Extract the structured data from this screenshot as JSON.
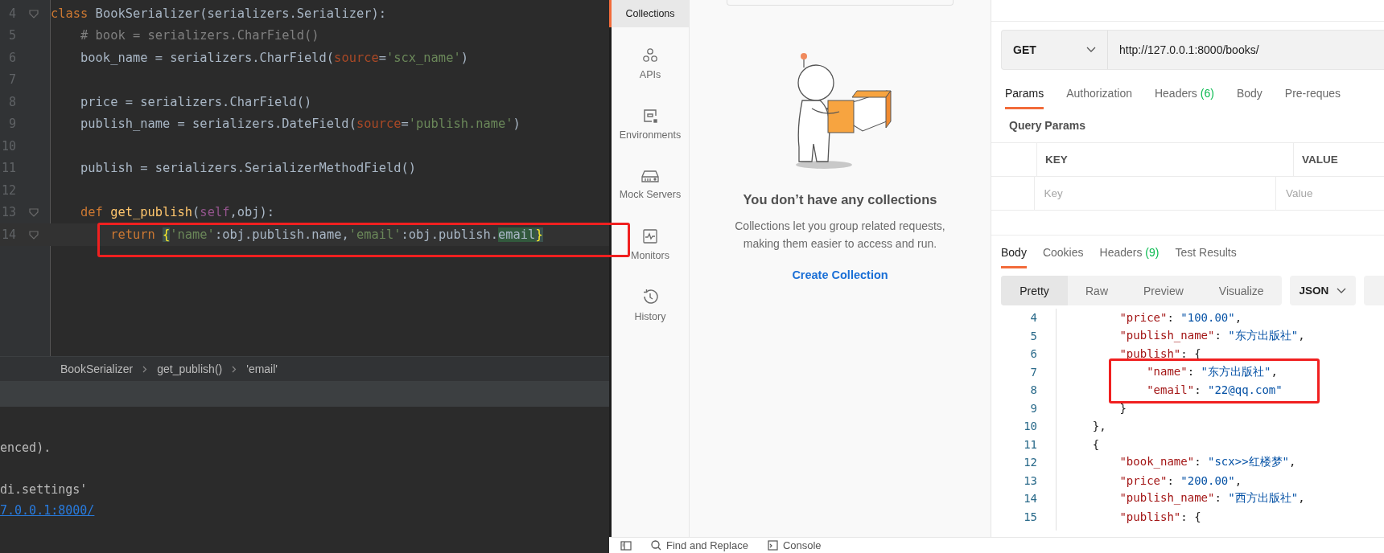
{
  "editor": {
    "lines": [
      {
        "number": "4",
        "fold": true,
        "current": false,
        "tokens": [
          {
            "kind": "keyword",
            "text": "class "
          },
          {
            "kind": "plain",
            "text": "BookSerializer(serializers.Serializer):"
          }
        ]
      },
      {
        "number": "5",
        "fold": false,
        "current": false,
        "tokens": [
          {
            "kind": "comment",
            "text": "    # book = serializers.CharField()"
          }
        ]
      },
      {
        "number": "6",
        "fold": false,
        "current": false,
        "tokens": [
          {
            "kind": "plain",
            "text": "    book_name = serializers.CharField("
          },
          {
            "kind": "param",
            "text": "source"
          },
          {
            "kind": "plain",
            "text": "="
          },
          {
            "kind": "string",
            "text": "'scx_name'"
          },
          {
            "kind": "plain",
            "text": ")"
          }
        ]
      },
      {
        "number": "7",
        "fold": false,
        "current": false
      },
      {
        "number": "8",
        "fold": false,
        "current": false,
        "tokens": [
          {
            "kind": "plain",
            "text": "    price = serializers.CharField()"
          }
        ]
      },
      {
        "number": "9",
        "fold": false,
        "current": false,
        "tokens": [
          {
            "kind": "plain",
            "text": "    publish_name = serializers.DateField("
          },
          {
            "kind": "param",
            "text": "source"
          },
          {
            "kind": "plain",
            "text": "="
          },
          {
            "kind": "string",
            "text": "'publish.name'"
          },
          {
            "kind": "plain",
            "text": ")"
          }
        ]
      },
      {
        "number": "10",
        "fold": false,
        "current": false
      },
      {
        "number": "11",
        "fold": false,
        "current": false,
        "tokens": [
          {
            "kind": "plain",
            "text": "    publish = serializers.SerializerMethodField()"
          }
        ]
      },
      {
        "number": "12",
        "fold": false,
        "current": false
      },
      {
        "number": "13",
        "fold": true,
        "current": false,
        "tokens": [
          {
            "kind": "keyword",
            "text": "    def "
          },
          {
            "kind": "func",
            "text": "get_publish"
          },
          {
            "kind": "plain",
            "text": "("
          },
          {
            "kind": "self",
            "text": "self"
          },
          {
            "kind": "plain",
            "text": ",obj):"
          }
        ]
      },
      {
        "number": "14",
        "fold": true,
        "current": true,
        "tokens": [
          {
            "kind": "keyword",
            "text": "        return "
          },
          {
            "kind": "brace",
            "text": "{"
          },
          {
            "kind": "string",
            "text": "'name'"
          },
          {
            "kind": "plain",
            "text": ":obj.publish.name,"
          },
          {
            "kind": "string",
            "text": "'email'"
          },
          {
            "kind": "plain",
            "text": ":obj.publish."
          },
          {
            "kind": "match",
            "text": "email"
          },
          {
            "kind": "brace",
            "text": "}"
          }
        ]
      }
    ],
    "breadcrumbs": [
      "BookSerializer",
      "get_publish()",
      "'email'"
    ]
  },
  "console": {
    "lines": [
      {
        "kind": "plain",
        "text": "enced)."
      },
      {
        "kind": "plain",
        "text": "di.settings'"
      },
      {
        "kind": "link",
        "text": "7.0.0.1:8000/"
      }
    ]
  },
  "sidebar": {
    "items": [
      {
        "label": "Collections",
        "selected": true
      },
      {
        "label": "APIs",
        "selected": false
      },
      {
        "label": "Environments",
        "selected": false
      },
      {
        "label": "Mock Servers",
        "selected": false
      },
      {
        "label": "Monitors",
        "selected": false
      },
      {
        "label": "History",
        "selected": false
      }
    ]
  },
  "collections": {
    "title": "You don’t have any collections",
    "description": "Collections let you group related requests, making them easier to access and run.",
    "action": "Create Collection"
  },
  "request": {
    "method": "GET",
    "url": "http://127.0.0.1:8000/books/",
    "tabs": [
      {
        "label": "Params",
        "selected": true
      },
      {
        "label": "Authorization",
        "selected": false
      },
      {
        "label": "Headers",
        "count": "(6)",
        "selected": false
      },
      {
        "label": "Body",
        "selected": false
      },
      {
        "label": "Pre-reques",
        "selected": false
      }
    ],
    "params_title": "Query Params",
    "table": {
      "columns": [
        "KEY",
        "VALUE"
      ],
      "placeholders": [
        "Key",
        "Value"
      ]
    }
  },
  "response": {
    "tabs": [
      {
        "label": "Body",
        "selected": true
      },
      {
        "label": "Cookies",
        "selected": false
      },
      {
        "label": "Headers",
        "count": "(9)",
        "selected": false
      },
      {
        "label": "Test Results",
        "selected": false
      }
    ],
    "views": [
      {
        "label": "Pretty",
        "selected": true
      },
      {
        "label": "Raw",
        "selected": false
      },
      {
        "label": "Preview",
        "selected": false
      },
      {
        "label": "Visualize",
        "selected": false
      }
    ],
    "format": "JSON",
    "lines": [
      {
        "number": "4",
        "tokens": [
          {
            "kind": "key",
            "text": "        \"price\""
          },
          {
            "kind": "punct",
            "text": ": "
          },
          {
            "kind": "str",
            "text": "\"100.00\""
          },
          {
            "kind": "punct",
            "text": ","
          }
        ]
      },
      {
        "number": "5",
        "tokens": [
          {
            "kind": "key",
            "text": "        \"publish_name\""
          },
          {
            "kind": "punct",
            "text": ": "
          },
          {
            "kind": "str",
            "text": "\"东方出版社\""
          },
          {
            "kind": "punct",
            "text": ","
          }
        ]
      },
      {
        "number": "6",
        "tokens": [
          {
            "kind": "key",
            "text": "        \"publish\""
          },
          {
            "kind": "punct",
            "text": ": {"
          }
        ]
      },
      {
        "number": "7",
        "tokens": [
          {
            "kind": "key",
            "text": "            \"name\""
          },
          {
            "kind": "punct",
            "text": ": "
          },
          {
            "kind": "str",
            "text": "\"东方出版社\""
          },
          {
            "kind": "punct",
            "text": ","
          }
        ]
      },
      {
        "number": "8",
        "tokens": [
          {
            "kind": "key",
            "text": "            \"email\""
          },
          {
            "kind": "punct",
            "text": ": "
          },
          {
            "kind": "str",
            "text": "\"22@qq.com\""
          }
        ]
      },
      {
        "number": "9",
        "tokens": [
          {
            "kind": "punct",
            "text": "        }"
          }
        ]
      },
      {
        "number": "10",
        "tokens": [
          {
            "kind": "punct",
            "text": "    },"
          }
        ]
      },
      {
        "number": "11",
        "tokens": [
          {
            "kind": "punct",
            "text": "    {"
          }
        ]
      },
      {
        "number": "12",
        "tokens": [
          {
            "kind": "key",
            "text": "        \"book_name\""
          },
          {
            "kind": "punct",
            "text": ": "
          },
          {
            "kind": "str",
            "text": "\"scx>>红楼梦\""
          },
          {
            "kind": "punct",
            "text": ","
          }
        ]
      },
      {
        "number": "13",
        "tokens": [
          {
            "kind": "key",
            "text": "        \"price\""
          },
          {
            "kind": "punct",
            "text": ": "
          },
          {
            "kind": "str",
            "text": "\"200.00\""
          },
          {
            "kind": "punct",
            "text": ","
          }
        ]
      },
      {
        "number": "14",
        "tokens": [
          {
            "kind": "key",
            "text": "        \"publish_name\""
          },
          {
            "kind": "punct",
            "text": ": "
          },
          {
            "kind": "str",
            "text": "\"西方出版社\""
          },
          {
            "kind": "punct",
            "text": ","
          }
        ]
      },
      {
        "number": "15",
        "tokens": [
          {
            "kind": "key",
            "text": "        \"publish\""
          },
          {
            "kind": "punct",
            "text": ": {"
          }
        ]
      }
    ]
  },
  "footer": {
    "items": [
      {
        "label": "Find and Replace"
      },
      {
        "label": "Console"
      }
    ]
  }
}
